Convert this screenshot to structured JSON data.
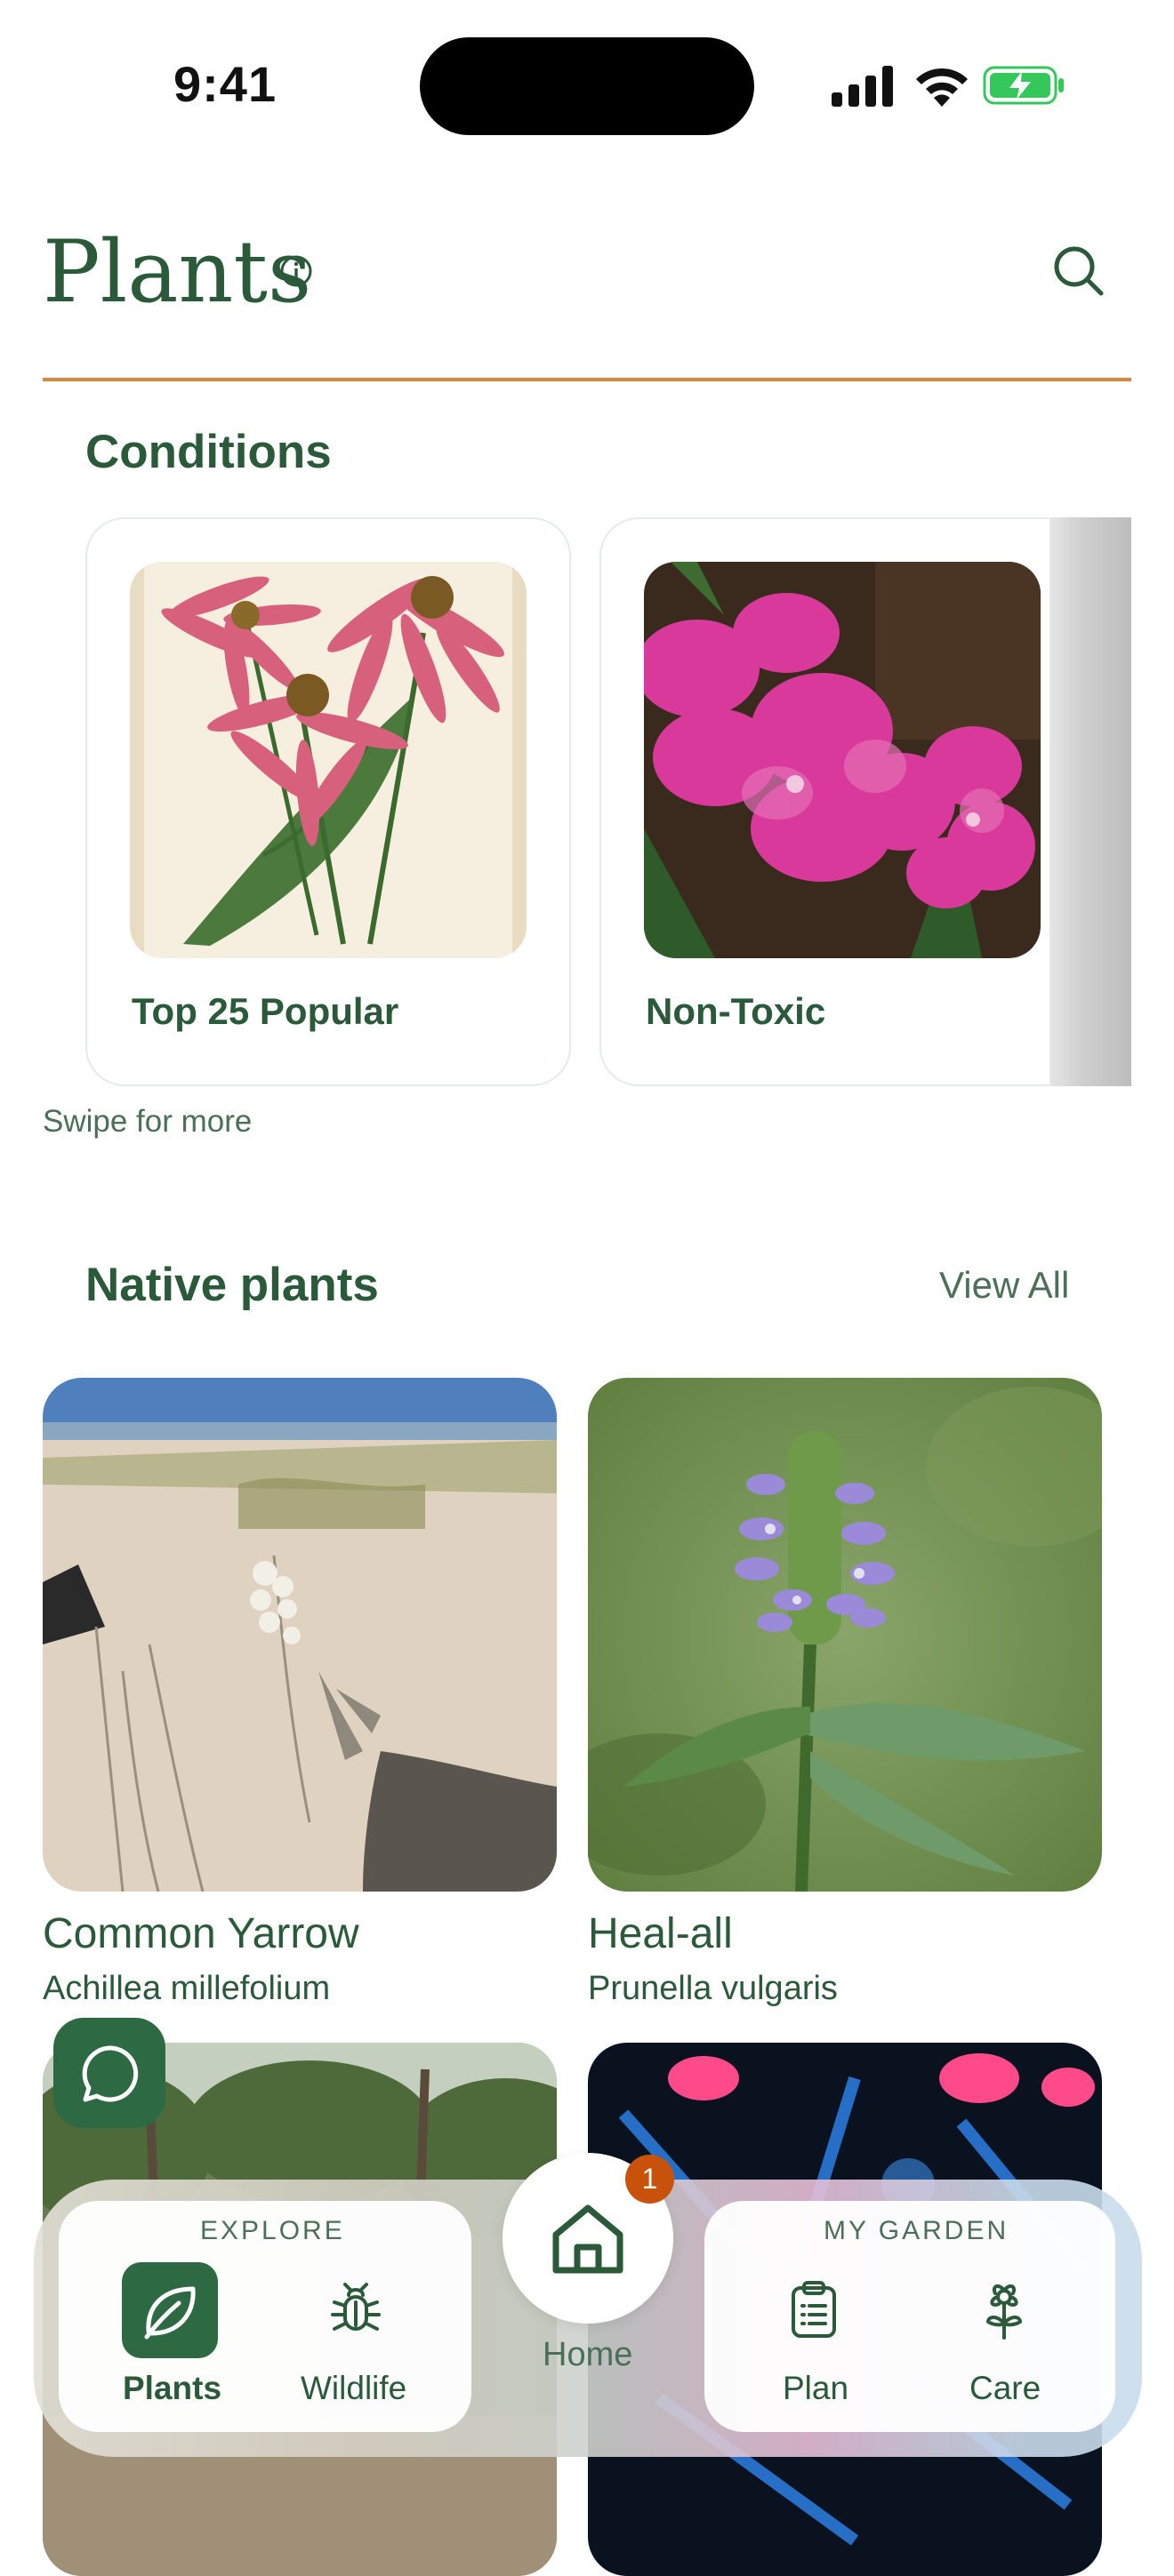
{
  "status_bar": {
    "time": "9:41"
  },
  "header": {
    "title": "Plants"
  },
  "conditions": {
    "title": "Conditions",
    "cards": [
      {
        "label": "Top 25 Popular"
      },
      {
        "label": "Non-Toxic"
      }
    ],
    "swipe_hint": "Swipe for more"
  },
  "native_plants": {
    "title": "Native plants",
    "view_all": "View All",
    "items": [
      {
        "name": "Common Yarrow",
        "scientific": "Achillea millefolium"
      },
      {
        "name": "Heal-all",
        "scientific": "Prunella vulgaris"
      }
    ]
  },
  "bottom_nav": {
    "explore_label": "EXPLORE",
    "garden_label": "MY GARDEN",
    "tabs": [
      {
        "label": "Plants",
        "icon": "leaf-icon"
      },
      {
        "label": "Wildlife",
        "icon": "bug-icon"
      },
      {
        "label": "Plan",
        "icon": "clipboard-icon"
      },
      {
        "label": "Care",
        "icon": "flower-icon"
      }
    ],
    "home": {
      "label": "Home",
      "badge": "1",
      "icon": "home-icon"
    }
  },
  "colors": {
    "brand_green": "#2a5a3a",
    "accent_orange": "#d9853b",
    "badge_orange": "#c8520a",
    "active_tab": "#2d6a43"
  }
}
